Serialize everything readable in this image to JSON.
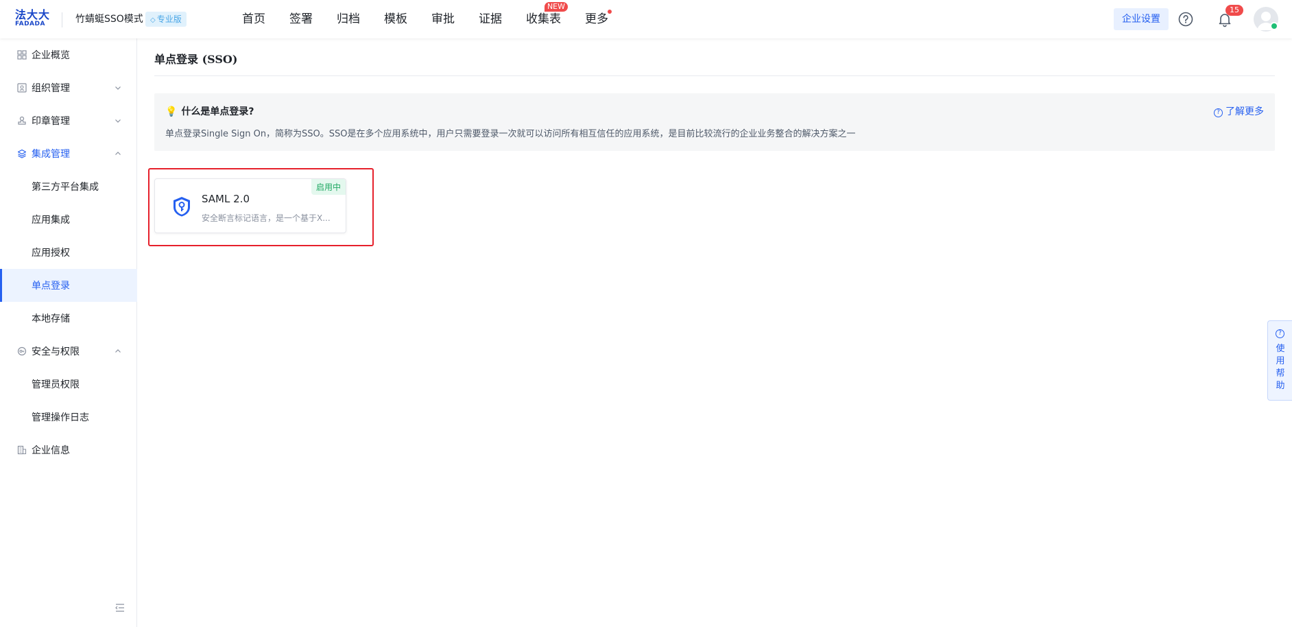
{
  "header": {
    "logo_main": "法大大",
    "logo_sub": "FADADA",
    "company": "竹蜻蜓SSO模式",
    "edition": "专业版",
    "nav": [
      {
        "label": "首页"
      },
      {
        "label": "签署"
      },
      {
        "label": "归档"
      },
      {
        "label": "模板"
      },
      {
        "label": "审批"
      },
      {
        "label": "证据"
      },
      {
        "label": "收集表",
        "badge": "NEW"
      },
      {
        "label": "更多",
        "dot": true
      }
    ],
    "enterprise_settings": "企业设置",
    "notification_count": "15"
  },
  "sidebar": {
    "items": [
      {
        "label": "企业概览"
      },
      {
        "label": "组织管理"
      },
      {
        "label": "印章管理"
      },
      {
        "label": "集成管理"
      },
      {
        "label": "第三方平台集成"
      },
      {
        "label": "应用集成"
      },
      {
        "label": "应用授权"
      },
      {
        "label": "单点登录"
      },
      {
        "label": "本地存储"
      },
      {
        "label": "安全与权限"
      },
      {
        "label": "管理员权限"
      },
      {
        "label": "管理操作日志"
      },
      {
        "label": "企业信息"
      }
    ]
  },
  "main": {
    "title": "单点登录 (SSO)",
    "info": {
      "title": "什么是单点登录?",
      "description": "单点登录Single Sign On，简称为SSO。SSO是在多个应用系统中，用户只需要登录一次就可以访问所有相互信任的应用系统，是目前比较流行的企业业务整合的解决方案之一",
      "learn_more": "了解更多"
    },
    "cards": [
      {
        "name": "SAML 2.0",
        "description": "安全断言标记语言，是一个基于X...",
        "status": "启用中"
      }
    ]
  },
  "help_tab": "使用帮助",
  "colors": {
    "accent": "#2660f0",
    "highlight": "#e6202b",
    "enabled": "#1fa862"
  }
}
